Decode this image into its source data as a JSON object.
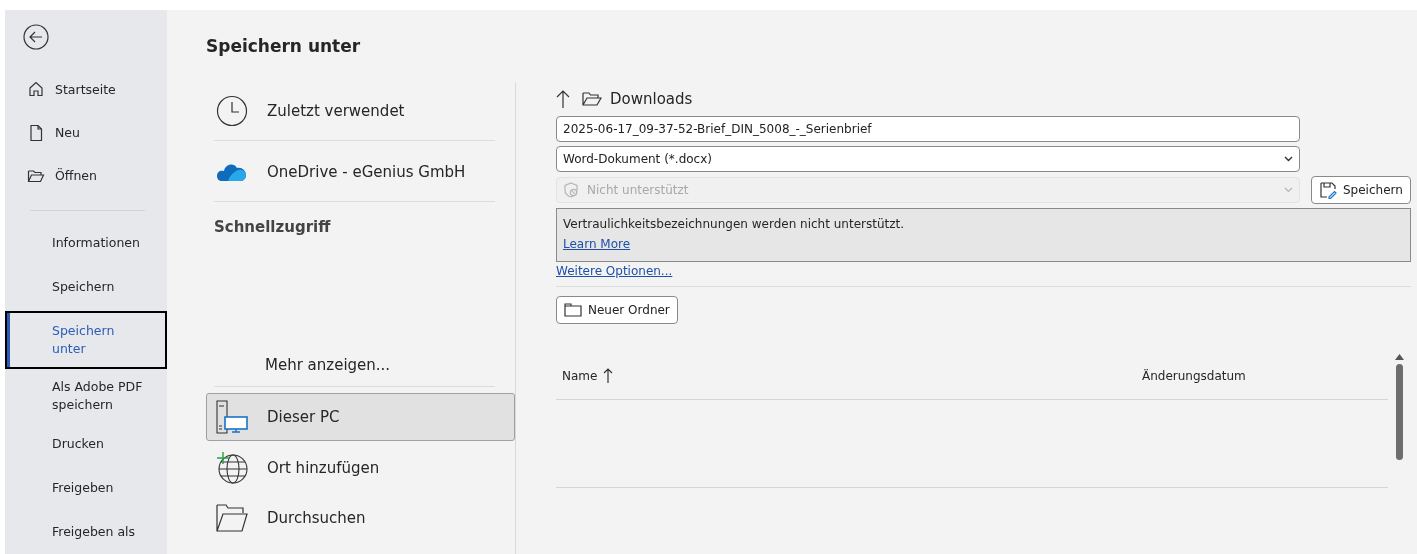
{
  "sidebar": {
    "nav": [
      {
        "label": "Startseite"
      },
      {
        "label": "Neu"
      },
      {
        "label": "Öffnen"
      }
    ],
    "menu": [
      {
        "label": "Informationen",
        "selected": false
      },
      {
        "label": "Speichern",
        "selected": false
      },
      {
        "label": "Speichern unter",
        "selected": true
      },
      {
        "label": "Als Adobe PDF speichern",
        "selected": false
      },
      {
        "label": "Drucken",
        "selected": false
      },
      {
        "label": "Freigeben",
        "selected": false
      },
      {
        "label": "Freigeben als",
        "selected": false
      }
    ]
  },
  "title": "Speichern unter",
  "locations": {
    "top": [
      {
        "label": "Zuletzt verwendet",
        "kind": "recent"
      },
      {
        "label": "OneDrive - eGenius GmbH",
        "kind": "cloud"
      }
    ],
    "heading": "Schnellzugriff",
    "more": "Mehr anzeigen...",
    "places": [
      {
        "label": "Dieser PC",
        "kind": "pc",
        "selected": true
      },
      {
        "label": "Ort hinzufügen",
        "kind": "add",
        "selected": false
      },
      {
        "label": "Durchsuchen",
        "kind": "browse",
        "selected": false
      }
    ]
  },
  "save": {
    "folder": "Downloads",
    "filename": "2025-06-17_09-37-52-Brief_DIN_5008_-_Serienbrief",
    "filetype": "Word-Dokument (*.docx)",
    "sensitivity": {
      "value": "Nicht unterstützt",
      "disabled": true
    },
    "save_button": "Speichern",
    "info": {
      "message": "Vertraulichkeitsbezeichnungen werden nicht unterstützt.",
      "link": "Learn More"
    },
    "more_options": "Weitere Optionen...",
    "new_folder": "Neuer Ordner",
    "table": {
      "columns": [
        {
          "label": "Name",
          "sorted": true
        },
        {
          "label": "Änderungsdatum",
          "sorted": false
        }
      ]
    }
  }
}
